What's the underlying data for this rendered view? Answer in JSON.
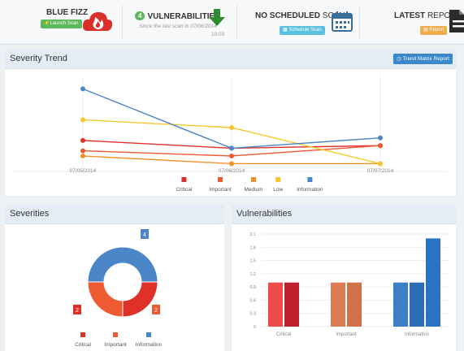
{
  "header": {
    "product": {
      "title": "BLUE FIZZ",
      "button": "Launch Scan"
    },
    "vulns": {
      "count": "4",
      "title": "VULNERABILITIES",
      "note": "Since the last scan in 07/06/2014",
      "time": "10:03"
    },
    "scan": {
      "title_bold": "NO SCHEDULED",
      "title_light": "SCAN",
      "button": "Schedule Scan"
    },
    "report": {
      "title_bold": "LATEST",
      "title_light": "REPORT",
      "button": "Report"
    }
  },
  "colors": {
    "critical": "#e0302a",
    "important": "#ee5a32",
    "medium": "#f0922b",
    "low": "#f6c72c",
    "information": "#4a86c8"
  },
  "trend": {
    "title": "Severity Trend",
    "report_button": "Trend Matrix Report",
    "chart_data": {
      "type": "line",
      "categories": [
        "07/05/2014",
        "07/06/2014",
        "07/07/2014"
      ],
      "series": [
        {
          "name": "Critical",
          "values": [
            1.0,
            0.85,
            0.9
          ]
        },
        {
          "name": "Important",
          "values": [
            0.8,
            0.7,
            0.9
          ]
        },
        {
          "name": "Medium",
          "values": [
            0.7,
            0.55,
            0.55
          ]
        },
        {
          "name": "Low",
          "values": [
            1.4,
            1.25,
            0.55
          ]
        },
        {
          "name": "Information",
          "values": [
            2.0,
            0.85,
            1.05
          ]
        }
      ],
      "ylim": [
        0.4,
        2.1
      ],
      "legend": "bottom",
      "grid": true
    }
  },
  "severities": {
    "title": "Severities",
    "chart_data": {
      "type": "pie",
      "labels": [
        "Critical",
        "Important",
        "Information"
      ],
      "values": [
        2,
        2,
        4
      ],
      "legend": "bottom"
    }
  },
  "vulnerabilities": {
    "title": "Vulnerabilities",
    "chart_data": {
      "type": "bar",
      "categories": [
        "Critical",
        "Important",
        "Information"
      ],
      "groups": [
        {
          "category": "Critical",
          "values": [
            1,
            1
          ]
        },
        {
          "category": "Important",
          "values": [
            1,
            1
          ]
        },
        {
          "category": "Information",
          "values": [
            1,
            1,
            2
          ]
        }
      ],
      "yticks": [
        "0",
        "0.3",
        "0.6",
        "0.9",
        "1.2",
        "1.5",
        "1.8",
        "2.1"
      ],
      "ylim": [
        0,
        2.1
      ],
      "grid": true
    }
  }
}
